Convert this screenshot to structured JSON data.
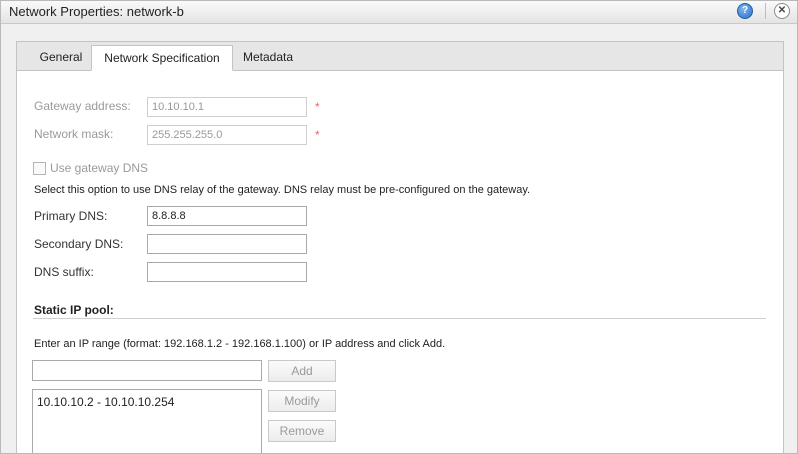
{
  "window": {
    "title": "Network Properties: network-b",
    "help_glyph": "?",
    "close_glyph": "✕"
  },
  "tabs": [
    {
      "label": "General"
    },
    {
      "label": "Network Specification"
    },
    {
      "label": "Metadata"
    }
  ],
  "form": {
    "gateway_label": "Gateway address:",
    "gateway_value": "10.10.10.1",
    "mask_label": "Network mask:",
    "mask_value": "255.255.255.0",
    "required_mark": "*",
    "use_gateway_dns_label": "Use gateway DNS",
    "use_gateway_dns_checked": false,
    "dns_hint": "Select this option to use DNS relay of the gateway. DNS relay must be pre-configured on the gateway.",
    "primary_dns_label": "Primary DNS:",
    "primary_dns_value": "8.8.8.8",
    "secondary_dns_label": "Secondary DNS:",
    "secondary_dns_value": "",
    "dns_suffix_label": "DNS suffix:",
    "dns_suffix_value": ""
  },
  "static_ip_pool": {
    "title": "Static IP pool:",
    "hint": "Enter an IP range (format: 192.168.1.2 - 192.168.1.100) or IP address and click Add.",
    "input_value": "",
    "items": [
      "10.10.10.2 - 10.10.10.254"
    ],
    "add_label": "Add",
    "modify_label": "Modify",
    "remove_label": "Remove"
  },
  "colors": {
    "required": "#e06a6a",
    "disabled_text": "#9a9a9a"
  }
}
